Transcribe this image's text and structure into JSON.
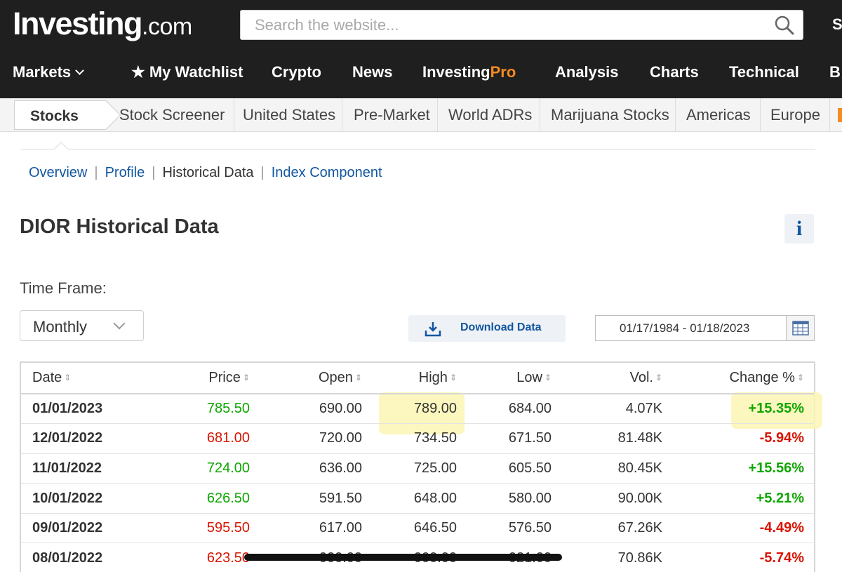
{
  "header": {
    "logo_main": "Investing",
    "logo_suffix": ".com",
    "search_placeholder": "Search the website...",
    "user_initial": "S"
  },
  "main_nav": [
    {
      "label": "Markets"
    },
    {
      "label": "★ My Watchlist"
    },
    {
      "label": "Crypto"
    },
    {
      "label": "News"
    },
    {
      "label": "Investing",
      "suffix": "Pro"
    },
    {
      "label": "Analysis"
    },
    {
      "label": "Charts"
    },
    {
      "label": "Technical"
    },
    {
      "label": "B"
    }
  ],
  "sub_nav": {
    "active": "Stocks",
    "items": [
      "Stock Screener",
      "United States",
      "Pre-Market",
      "World ADRs",
      "Marijuana Stocks",
      "Americas",
      "Europe"
    ]
  },
  "sections": {
    "overview": "Overview",
    "profile": "Profile",
    "historical": "Historical Data",
    "index_component": "Index Component"
  },
  "page": {
    "title": "DIOR Historical Data",
    "info_label": "i",
    "timeframe_label": "Time Frame:",
    "timeframe_value": "Monthly",
    "download_label": "Download Data",
    "date_range": "01/17/1984 - 01/18/2023"
  },
  "table": {
    "columns": [
      "Date",
      "Price",
      "Open",
      "High",
      "Low",
      "Vol.",
      "Change %"
    ],
    "rows": [
      [
        "01/01/2023",
        "785.50",
        "690.00",
        "789.00",
        "684.00",
        "4.07K",
        "+15.35%"
      ],
      [
        "12/01/2022",
        "681.00",
        "720.00",
        "734.50",
        "671.50",
        "81.48K",
        "-5.94%"
      ],
      [
        "11/01/2022",
        "724.00",
        "636.00",
        "725.00",
        "605.50",
        "80.45K",
        "+15.56%"
      ],
      [
        "10/01/2022",
        "626.50",
        "591.50",
        "648.00",
        "580.00",
        "90.00K",
        "+5.21%"
      ],
      [
        "09/01/2022",
        "595.50",
        "617.00",
        "646.50",
        "576.50",
        "67.26K",
        "-4.49%"
      ],
      [
        "08/01/2022",
        "623.50",
        "000.00",
        "000.00",
        "021.00",
        "70.86K",
        "-5.74%"
      ]
    ]
  },
  "colors": {
    "header_bg": "#1f1f1f",
    "link": "#1256a0",
    "positive": "#0ea600",
    "negative": "#d91400",
    "pro_accent": "#f68b1f",
    "highlight": "#fbf6b4"
  }
}
